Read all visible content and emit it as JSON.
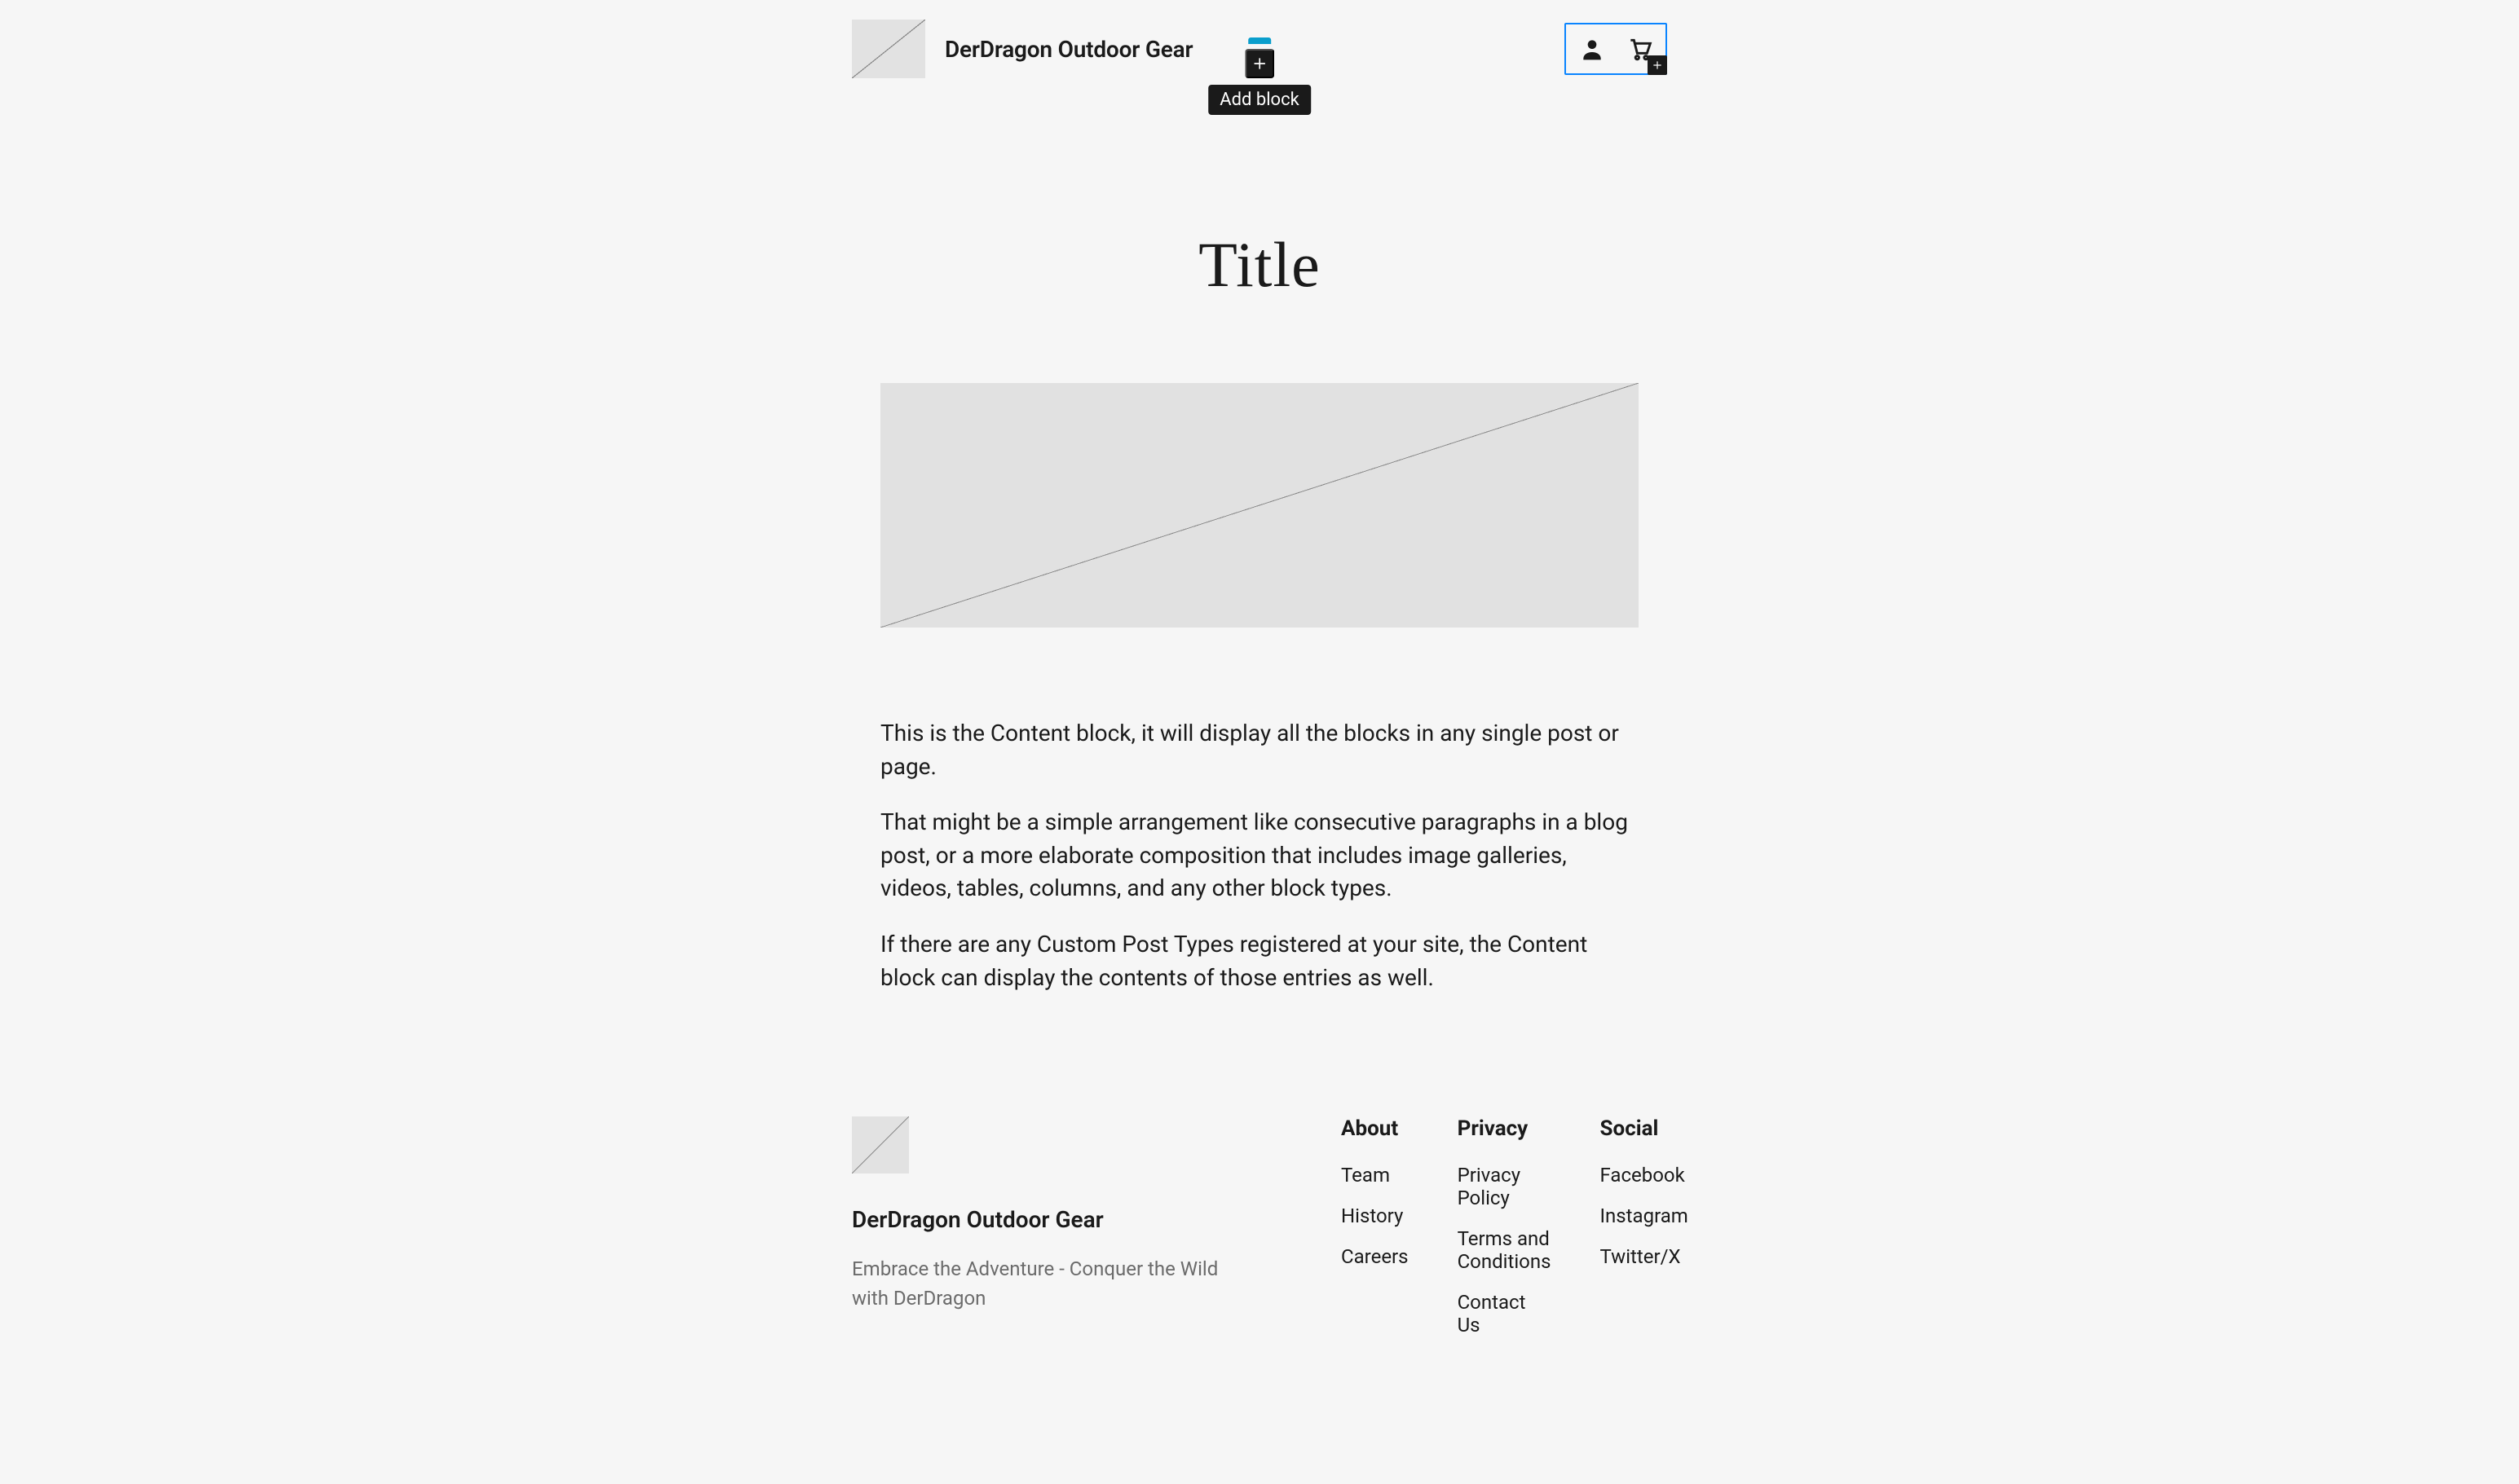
{
  "header": {
    "site_title": "DerDragon Outdoor Gear",
    "add_block_label": "Add block"
  },
  "page": {
    "title": "Title",
    "paragraphs": [
      "This is the Content block, it will display all the blocks in any single post or page.",
      "That might be a simple arrangement like consecutive paragraphs in a blog post, or a more elaborate composition that includes image galleries, videos, tables, columns, and any other block types.",
      "If there are any Custom Post Types registered at your site, the Content block can display the contents of those entries as well."
    ]
  },
  "footer": {
    "site_title": "DerDragon Outdoor Gear",
    "tagline": "Embrace the Adventure - Conquer the Wild with DerDragon",
    "columns": [
      {
        "heading": "About",
        "links": [
          "Team",
          "History",
          "Careers"
        ]
      },
      {
        "heading": "Privacy",
        "links": [
          "Privacy Policy",
          "Terms and Conditions",
          "Contact Us"
        ]
      },
      {
        "heading": "Social",
        "links": [
          "Facebook",
          "Instagram",
          "Twitter/X"
        ]
      }
    ]
  }
}
